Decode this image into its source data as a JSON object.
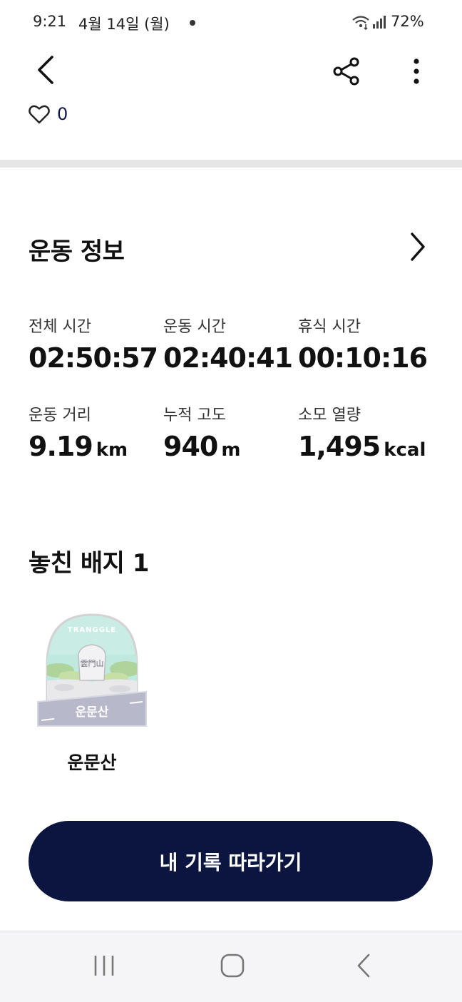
{
  "status_bar": {
    "time": "9:21",
    "date": "4월 14일 (월)",
    "battery": "72%",
    "icons": [
      "wifi-icon",
      "signal-icon"
    ]
  },
  "header": {
    "icons": [
      "back-arrow-icon",
      "share-icon",
      "more-vertical-icon"
    ],
    "like_count": "0"
  },
  "workout_info": {
    "title": "운동 정보",
    "stats": [
      {
        "label": "전체 시간",
        "value": "02:50:57",
        "unit": ""
      },
      {
        "label": "운동 시간",
        "value": "02:40:41",
        "unit": ""
      },
      {
        "label": "휴식 시간",
        "value": "00:10:16",
        "unit": ""
      },
      {
        "label": "운동 거리",
        "value": "9.19",
        "unit": "km"
      },
      {
        "label": "누적 고도",
        "value": "940",
        "unit": "m"
      },
      {
        "label": "소모 열량",
        "value": "1,495",
        "unit": "kcal"
      }
    ]
  },
  "badges": {
    "title": "놓친 배지 1",
    "items": [
      {
        "name": "운문산",
        "emblem_text": "운문산",
        "arc_text": "TRANGGLE",
        "stone_text": "雲門山"
      }
    ]
  },
  "cta": {
    "label": "내 기록 따라가기"
  },
  "colors": {
    "primary": "#0b1540",
    "divider": "#e6e6e6",
    "text": "#111111"
  }
}
